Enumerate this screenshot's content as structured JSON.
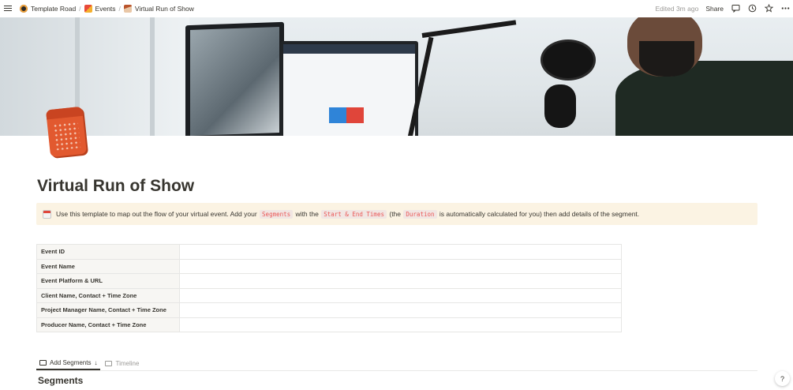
{
  "breadcrumb": [
    {
      "label": "Template Road",
      "icon": "template-road-icon"
    },
    {
      "label": "Events",
      "icon": "events-icon"
    },
    {
      "label": "Virtual Run of Show",
      "icon": "virtual-run-icon"
    }
  ],
  "topbar": {
    "edited": "Edited 3m ago",
    "share_label": "Share"
  },
  "page": {
    "title": "Virtual Run of Show"
  },
  "callout": {
    "icon": "calendar-icon",
    "text1": "Use this template to map out the flow of your virtual event. Add your",
    "code1": "Segments",
    "text2": "with the",
    "code2": "Start & End Times",
    "text3": "(the",
    "code3": "Duration",
    "text4": "is automatically calculated for you) then add details of the segment."
  },
  "properties": [
    {
      "label": "Event ID",
      "value": ""
    },
    {
      "label": "Event Name",
      "value": ""
    },
    {
      "label": "Event Platform & URL",
      "value": ""
    },
    {
      "label": "Client Name, Contact + Time Zone",
      "value": ""
    },
    {
      "label": "Project Manager Name, Contact + Time Zone",
      "value": ""
    },
    {
      "label": "Producer Name, Contact + Time Zone",
      "value": ""
    }
  ],
  "tabs": [
    {
      "label": "Add Segments",
      "active": true
    },
    {
      "label": "Timeline",
      "active": false
    }
  ],
  "section_title": "Segments",
  "help_label": "?"
}
